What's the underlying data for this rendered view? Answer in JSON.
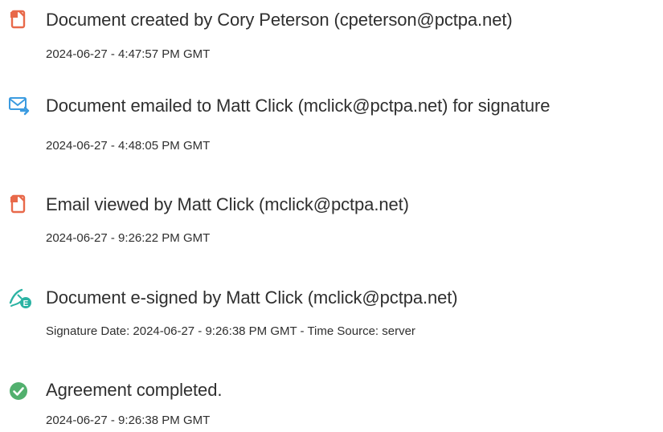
{
  "colors": {
    "doc_icon": "#e8694a",
    "email_icon": "#3b9be0",
    "sign_icon": "#2bb3a3",
    "check_icon": "#52b06e",
    "text": "#2f2f2f"
  },
  "events": [
    {
      "icon": "document-icon",
      "title": "Document created by Cory Peterson (cpeterson@pctpa.net)",
      "detail": "2024-06-27 - 4:47:57 PM GMT"
    },
    {
      "icon": "email-forward-icon",
      "title": "Document emailed to Matt Click (mclick@pctpa.net) for signature",
      "detail": "2024-06-27 - 4:48:05 PM GMT"
    },
    {
      "icon": "document-icon",
      "title": "Email viewed by Matt Click (mclick@pctpa.net)",
      "detail": "2024-06-27 - 9:26:22 PM GMT"
    },
    {
      "icon": "esign-pen-icon",
      "title": "Document e-signed by Matt Click (mclick@pctpa.net)",
      "detail": "Signature Date: 2024-06-27 - 9:26:38 PM GMT - Time Source: server"
    },
    {
      "icon": "checkmark-circle-icon",
      "title": "Agreement completed.",
      "detail": "2024-06-27 - 9:26:38 PM GMT"
    }
  ]
}
